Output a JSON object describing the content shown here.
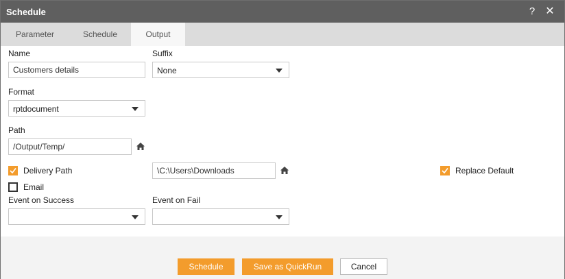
{
  "window": {
    "title": "Schedule",
    "help_glyph": "?",
    "close_glyph": "✕"
  },
  "tabs": [
    {
      "label": "Parameter",
      "active": false
    },
    {
      "label": "Schedule",
      "active": false
    },
    {
      "label": "Output",
      "active": true
    }
  ],
  "form": {
    "name": {
      "label": "Name",
      "value": "Customers details"
    },
    "suffix": {
      "label": "Suffix",
      "value": "None"
    },
    "format": {
      "label": "Format",
      "value": "rptdocument"
    },
    "path": {
      "label": "Path",
      "value": "/Output/Temp/"
    },
    "delivery_path": {
      "label": "Delivery Path",
      "checked": true,
      "value": "\\C:\\Users\\Downloads"
    },
    "replace_default": {
      "label": "Replace Default",
      "checked": true
    },
    "email": {
      "label": "Email",
      "checked": false
    },
    "event_on_success": {
      "label": "Event on Success",
      "value": ""
    },
    "event_on_fail": {
      "label": "Event on Fail",
      "value": ""
    }
  },
  "footer": {
    "schedule_label": "Schedule",
    "quickrun_label": "Save as QuickRun",
    "cancel_label": "Cancel"
  },
  "colors": {
    "titlebar": "#5f5f5f",
    "accent": "#f39c2c",
    "tabbar": "#dcdcdc"
  },
  "icons": [
    "help-icon",
    "close-icon",
    "home-icon",
    "checkmark-icon",
    "dropdown-arrow-icon"
  ]
}
